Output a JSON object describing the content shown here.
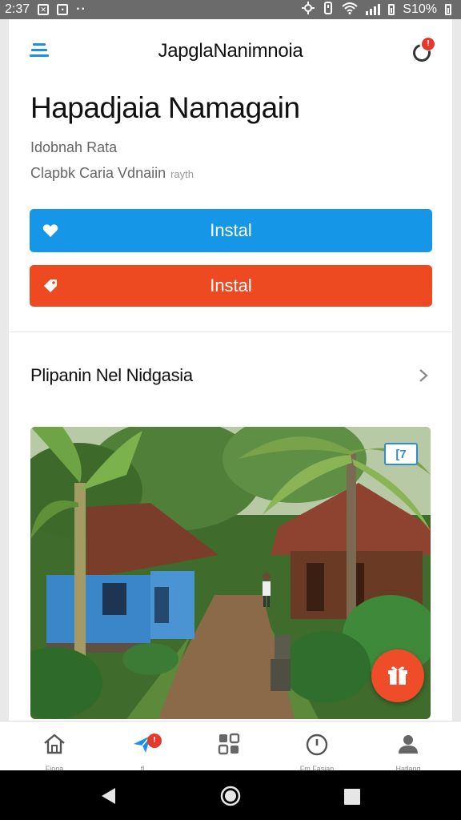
{
  "status_bar": {
    "time": "2:37",
    "battery_text": "S10%",
    "icons": [
      "notification-box-icon",
      "notification-box-icon",
      "more-dots-icon",
      "location-icon",
      "vibrate-icon",
      "wifi-icon",
      "signal-icon",
      "battery-icon"
    ]
  },
  "header": {
    "title": "JapglaNanimnoia",
    "notification_badge": "!"
  },
  "app": {
    "title": "Hapadjaia Namagain",
    "subtitle_1": "Idobnah Rata",
    "subtitle_2": "Clapbk Caria Vdnaiin",
    "subtitle_2_faint": "rayth"
  },
  "buttons": {
    "primary_label": "Instal",
    "secondary_label": "Instal"
  },
  "section": {
    "title": "Plipanin Nel Nidgasia"
  },
  "hero": {
    "badge_text": "[7"
  },
  "bottom_nav": {
    "items": [
      {
        "icon": "home-icon",
        "label": "Fiona"
      },
      {
        "icon": "send-icon",
        "label": "fl",
        "badge": "!"
      },
      {
        "icon": "grid-icon",
        "label": ""
      },
      {
        "icon": "clock-icon",
        "label": "Fm Fasian"
      },
      {
        "icon": "profile-icon",
        "label": "Hatlang"
      }
    ]
  },
  "colors": {
    "primary_blue": "#1696e6",
    "accent_red": "#ee4a21",
    "status_bar": "#6b6b6b"
  }
}
